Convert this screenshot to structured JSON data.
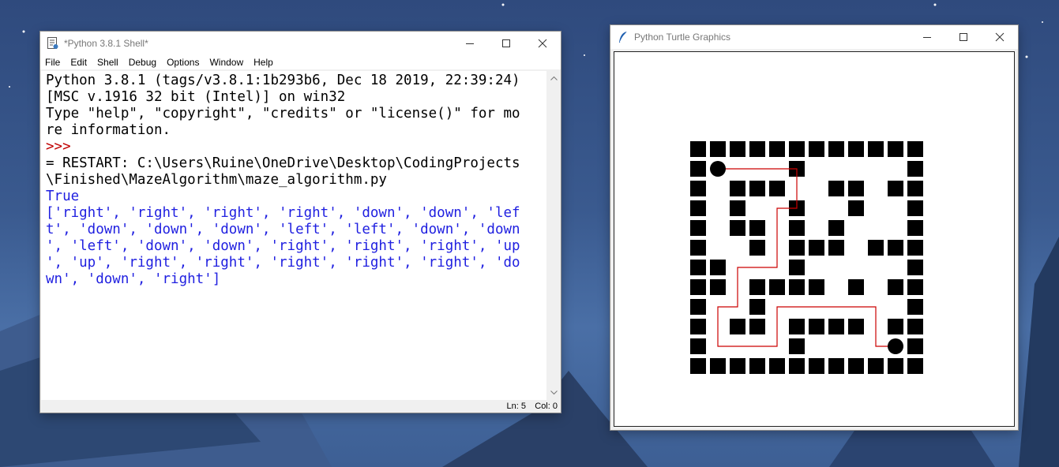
{
  "shell_window": {
    "title": "*Python 3.8.1 Shell*",
    "menu": [
      "File",
      "Edit",
      "Shell",
      "Debug",
      "Options",
      "Window",
      "Help"
    ],
    "lines": [
      {
        "text": "Python 3.8.1 (tags/v3.8.1:1b293b6, Dec 18 2019, 22:39:24)",
        "kind": "out"
      },
      {
        "text": "[MSC v.1916 32 bit (Intel)] on win32",
        "kind": "out"
      },
      {
        "text": "Type \"help\", \"copyright\", \"credits\" or \"license()\" for mo",
        "kind": "out"
      },
      {
        "text": "re information.",
        "kind": "out"
      },
      {
        "text": ">>> ",
        "kind": "prompt"
      },
      {
        "text": "= RESTART: C:\\Users\\Ruine\\OneDrive\\Desktop\\CodingProjects",
        "kind": "out"
      },
      {
        "text": "\\Finished\\MazeAlgorithm\\maze_algorithm.py",
        "kind": "out"
      },
      {
        "text": "True",
        "kind": "blue"
      },
      {
        "text": "['right', 'right', 'right', 'right', 'down', 'down', 'lef",
        "kind": "blue"
      },
      {
        "text": "t', 'down', 'down', 'down', 'left', 'left', 'down', 'down",
        "kind": "blue"
      },
      {
        "text": "', 'left', 'down', 'down', 'right', 'right', 'right', 'up",
        "kind": "blue"
      },
      {
        "text": "', 'up', 'right', 'right', 'right', 'right', 'right', 'do",
        "kind": "blue"
      },
      {
        "text": "wn', 'down', 'right']",
        "kind": "blue"
      }
    ],
    "status": {
      "ln": "Ln: 5",
      "col": "Col: 0"
    }
  },
  "turtle_window": {
    "title": "Python Turtle Graphics",
    "maze": [
      "############",
      "#S   #     #",
      "# ###  ## ##",
      "# #  #  #  #",
      "# ## # #   #",
      "#  # ### ###",
      "##   #     #",
      "## #### # ##",
      "#  #       #",
      "# ## #### ##",
      "#    #    E#",
      "############"
    ],
    "path": [
      "right",
      "right",
      "right",
      "right",
      "down",
      "down",
      "left",
      "down",
      "down",
      "down",
      "left",
      "left",
      "down",
      "down",
      "left",
      "down",
      "down",
      "right",
      "right",
      "right",
      "up",
      "up",
      "right",
      "right",
      "right",
      "right",
      "right",
      "down",
      "down",
      "right"
    ],
    "wall_color": "#000000",
    "path_color": "#cc0000"
  },
  "icons": [
    "python-idle-icon",
    "turtle-feather-icon",
    "minimize-icon",
    "maximize-icon",
    "close-icon"
  ]
}
